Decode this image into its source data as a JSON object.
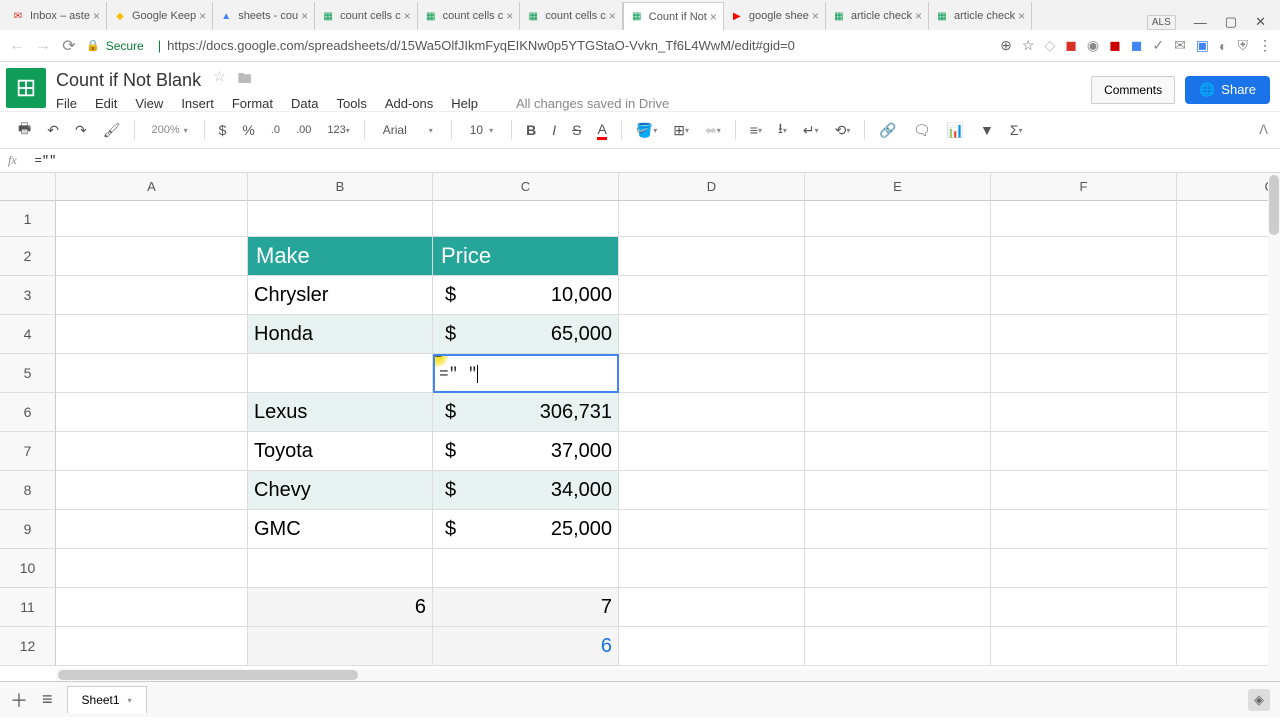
{
  "browser": {
    "tabs": [
      {
        "title": "Inbox – aste",
        "icon": "✉",
        "color": "#d93025"
      },
      {
        "title": "Google Keep",
        "icon": "◆",
        "color": "#fbbc04"
      },
      {
        "title": "sheets - cou",
        "icon": "▲",
        "color": "#4285f4"
      },
      {
        "title": "count cells c",
        "icon": "▦",
        "color": "#0f9d58"
      },
      {
        "title": "count cells c",
        "icon": "▦",
        "color": "#0f9d58"
      },
      {
        "title": "count cells c",
        "icon": "▦",
        "color": "#0f9d58"
      },
      {
        "title": "Count if Not",
        "icon": "▦",
        "color": "#0f9d58",
        "active": true
      },
      {
        "title": "google shee",
        "icon": "▶",
        "color": "#ff0000"
      },
      {
        "title": "article check",
        "icon": "▦",
        "color": "#0f9d58"
      },
      {
        "title": "article check",
        "icon": "▦",
        "color": "#0f9d58"
      }
    ],
    "user_badge": "ALS",
    "url": "https://docs.google.com/spreadsheets/d/15Wa5OlfJIkmFyqEIKNw0p5YTGStaO-Vvkn_Tf6L4WwM/edit#gid=0",
    "secure_label": "Secure"
  },
  "doc": {
    "title": "Count if Not Blank",
    "menus": [
      "File",
      "Edit",
      "View",
      "Insert",
      "Format",
      "Data",
      "Tools",
      "Add-ons",
      "Help"
    ],
    "save_status": "All changes saved in Drive",
    "comments_label": "Comments",
    "share_label": "Share"
  },
  "toolbar": {
    "zoom": "200%",
    "font": "Arial",
    "font_size": "10",
    "num_format": "123"
  },
  "formula": "=\"\"",
  "columns": [
    "A",
    "B",
    "C",
    "D",
    "E",
    "F",
    "G"
  ],
  "rows": [
    "1",
    "2",
    "3",
    "4",
    "5",
    "6",
    "7",
    "8",
    "9",
    "10",
    "11",
    "12"
  ],
  "table": {
    "header_make": "Make",
    "header_price": "Price",
    "rows": [
      {
        "make": "Chrysler",
        "price": "10,000"
      },
      {
        "make": "Honda",
        "price": "65,000"
      },
      {
        "make": "",
        "price": "",
        "editing": true
      },
      {
        "make": "Lexus",
        "price": "306,731"
      },
      {
        "make": "Toyota",
        "price": "37,000"
      },
      {
        "make": "Chevy",
        "price": "34,000"
      },
      {
        "make": "GMC",
        "price": "25,000"
      }
    ],
    "edit_value": "=\" \""
  },
  "counts": {
    "b11": "6",
    "c11": "7",
    "c12": "6"
  },
  "sheet_tab": "Sheet1"
}
